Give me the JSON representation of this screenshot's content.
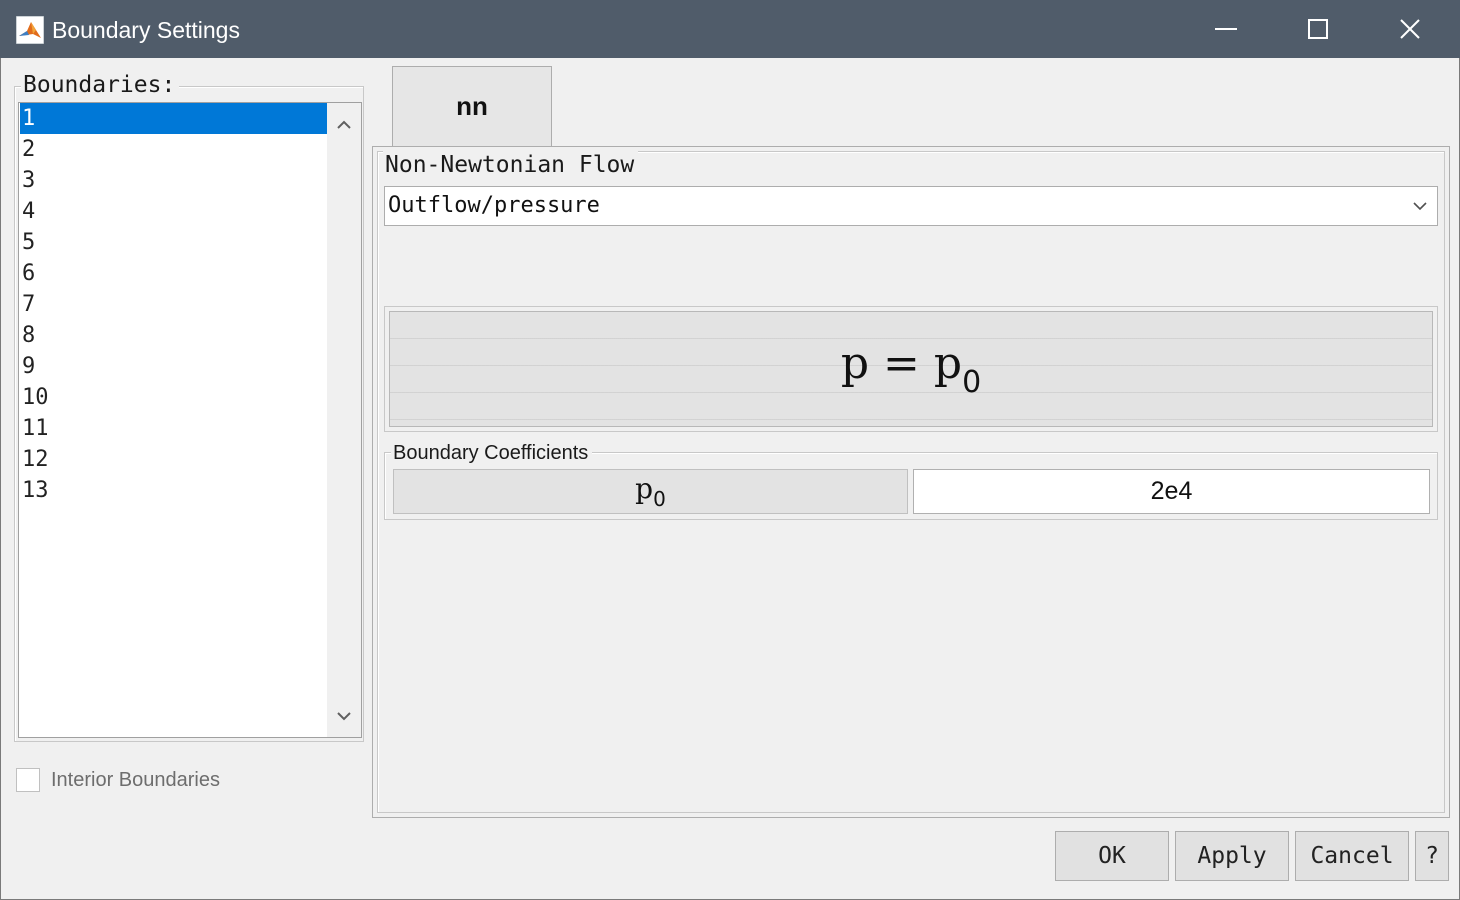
{
  "window": {
    "title": "Boundary Settings",
    "minimize_icon": "minimize-icon",
    "maximize_icon": "maximize-icon",
    "close_icon": "close-icon",
    "app_icon": "matlab-icon"
  },
  "boundaries": {
    "label": "Boundaries:",
    "items": [
      "1",
      "2",
      "3",
      "4",
      "5",
      "6",
      "7",
      "8",
      "9",
      "10",
      "11",
      "12",
      "13"
    ],
    "selected_index": 0
  },
  "interior": {
    "label": "Interior Boundaries",
    "checked": false
  },
  "tab": {
    "label": "nn"
  },
  "flow": {
    "group_label": "Non-Newtonian Flow",
    "type_value": "Outflow/pressure"
  },
  "equation": {
    "lhs": "p",
    "equals": "=",
    "rhs": "p",
    "rhs_sub": "0"
  },
  "coefficients": {
    "group_label": "Boundary Coefficients",
    "rows": [
      {
        "name": "p",
        "sub": "0",
        "value": "2e4"
      }
    ]
  },
  "buttons": {
    "ok": "OK",
    "apply": "Apply",
    "cancel": "Cancel",
    "help": "?"
  },
  "colors": {
    "titlebar": "#505c6a",
    "selection": "#0078d7"
  }
}
